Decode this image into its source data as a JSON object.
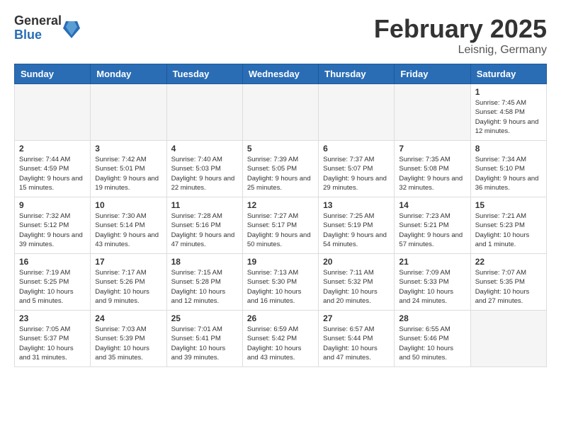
{
  "header": {
    "logo_general": "General",
    "logo_blue": "Blue",
    "month_title": "February 2025",
    "location": "Leisnig, Germany"
  },
  "columns": [
    "Sunday",
    "Monday",
    "Tuesday",
    "Wednesday",
    "Thursday",
    "Friday",
    "Saturday"
  ],
  "weeks": [
    [
      {
        "day": "",
        "info": ""
      },
      {
        "day": "",
        "info": ""
      },
      {
        "day": "",
        "info": ""
      },
      {
        "day": "",
        "info": ""
      },
      {
        "day": "",
        "info": ""
      },
      {
        "day": "",
        "info": ""
      },
      {
        "day": "1",
        "info": "Sunrise: 7:45 AM\nSunset: 4:58 PM\nDaylight: 9 hours and 12 minutes."
      }
    ],
    [
      {
        "day": "2",
        "info": "Sunrise: 7:44 AM\nSunset: 4:59 PM\nDaylight: 9 hours and 15 minutes."
      },
      {
        "day": "3",
        "info": "Sunrise: 7:42 AM\nSunset: 5:01 PM\nDaylight: 9 hours and 19 minutes."
      },
      {
        "day": "4",
        "info": "Sunrise: 7:40 AM\nSunset: 5:03 PM\nDaylight: 9 hours and 22 minutes."
      },
      {
        "day": "5",
        "info": "Sunrise: 7:39 AM\nSunset: 5:05 PM\nDaylight: 9 hours and 25 minutes."
      },
      {
        "day": "6",
        "info": "Sunrise: 7:37 AM\nSunset: 5:07 PM\nDaylight: 9 hours and 29 minutes."
      },
      {
        "day": "7",
        "info": "Sunrise: 7:35 AM\nSunset: 5:08 PM\nDaylight: 9 hours and 32 minutes."
      },
      {
        "day": "8",
        "info": "Sunrise: 7:34 AM\nSunset: 5:10 PM\nDaylight: 9 hours and 36 minutes."
      }
    ],
    [
      {
        "day": "9",
        "info": "Sunrise: 7:32 AM\nSunset: 5:12 PM\nDaylight: 9 hours and 39 minutes."
      },
      {
        "day": "10",
        "info": "Sunrise: 7:30 AM\nSunset: 5:14 PM\nDaylight: 9 hours and 43 minutes."
      },
      {
        "day": "11",
        "info": "Sunrise: 7:28 AM\nSunset: 5:16 PM\nDaylight: 9 hours and 47 minutes."
      },
      {
        "day": "12",
        "info": "Sunrise: 7:27 AM\nSunset: 5:17 PM\nDaylight: 9 hours and 50 minutes."
      },
      {
        "day": "13",
        "info": "Sunrise: 7:25 AM\nSunset: 5:19 PM\nDaylight: 9 hours and 54 minutes."
      },
      {
        "day": "14",
        "info": "Sunrise: 7:23 AM\nSunset: 5:21 PM\nDaylight: 9 hours and 57 minutes."
      },
      {
        "day": "15",
        "info": "Sunrise: 7:21 AM\nSunset: 5:23 PM\nDaylight: 10 hours and 1 minute."
      }
    ],
    [
      {
        "day": "16",
        "info": "Sunrise: 7:19 AM\nSunset: 5:25 PM\nDaylight: 10 hours and 5 minutes."
      },
      {
        "day": "17",
        "info": "Sunrise: 7:17 AM\nSunset: 5:26 PM\nDaylight: 10 hours and 9 minutes."
      },
      {
        "day": "18",
        "info": "Sunrise: 7:15 AM\nSunset: 5:28 PM\nDaylight: 10 hours and 12 minutes."
      },
      {
        "day": "19",
        "info": "Sunrise: 7:13 AM\nSunset: 5:30 PM\nDaylight: 10 hours and 16 minutes."
      },
      {
        "day": "20",
        "info": "Sunrise: 7:11 AM\nSunset: 5:32 PM\nDaylight: 10 hours and 20 minutes."
      },
      {
        "day": "21",
        "info": "Sunrise: 7:09 AM\nSunset: 5:33 PM\nDaylight: 10 hours and 24 minutes."
      },
      {
        "day": "22",
        "info": "Sunrise: 7:07 AM\nSunset: 5:35 PM\nDaylight: 10 hours and 27 minutes."
      }
    ],
    [
      {
        "day": "23",
        "info": "Sunrise: 7:05 AM\nSunset: 5:37 PM\nDaylight: 10 hours and 31 minutes."
      },
      {
        "day": "24",
        "info": "Sunrise: 7:03 AM\nSunset: 5:39 PM\nDaylight: 10 hours and 35 minutes."
      },
      {
        "day": "25",
        "info": "Sunrise: 7:01 AM\nSunset: 5:41 PM\nDaylight: 10 hours and 39 minutes."
      },
      {
        "day": "26",
        "info": "Sunrise: 6:59 AM\nSunset: 5:42 PM\nDaylight: 10 hours and 43 minutes."
      },
      {
        "day": "27",
        "info": "Sunrise: 6:57 AM\nSunset: 5:44 PM\nDaylight: 10 hours and 47 minutes."
      },
      {
        "day": "28",
        "info": "Sunrise: 6:55 AM\nSunset: 5:46 PM\nDaylight: 10 hours and 50 minutes."
      },
      {
        "day": "",
        "info": ""
      }
    ]
  ]
}
